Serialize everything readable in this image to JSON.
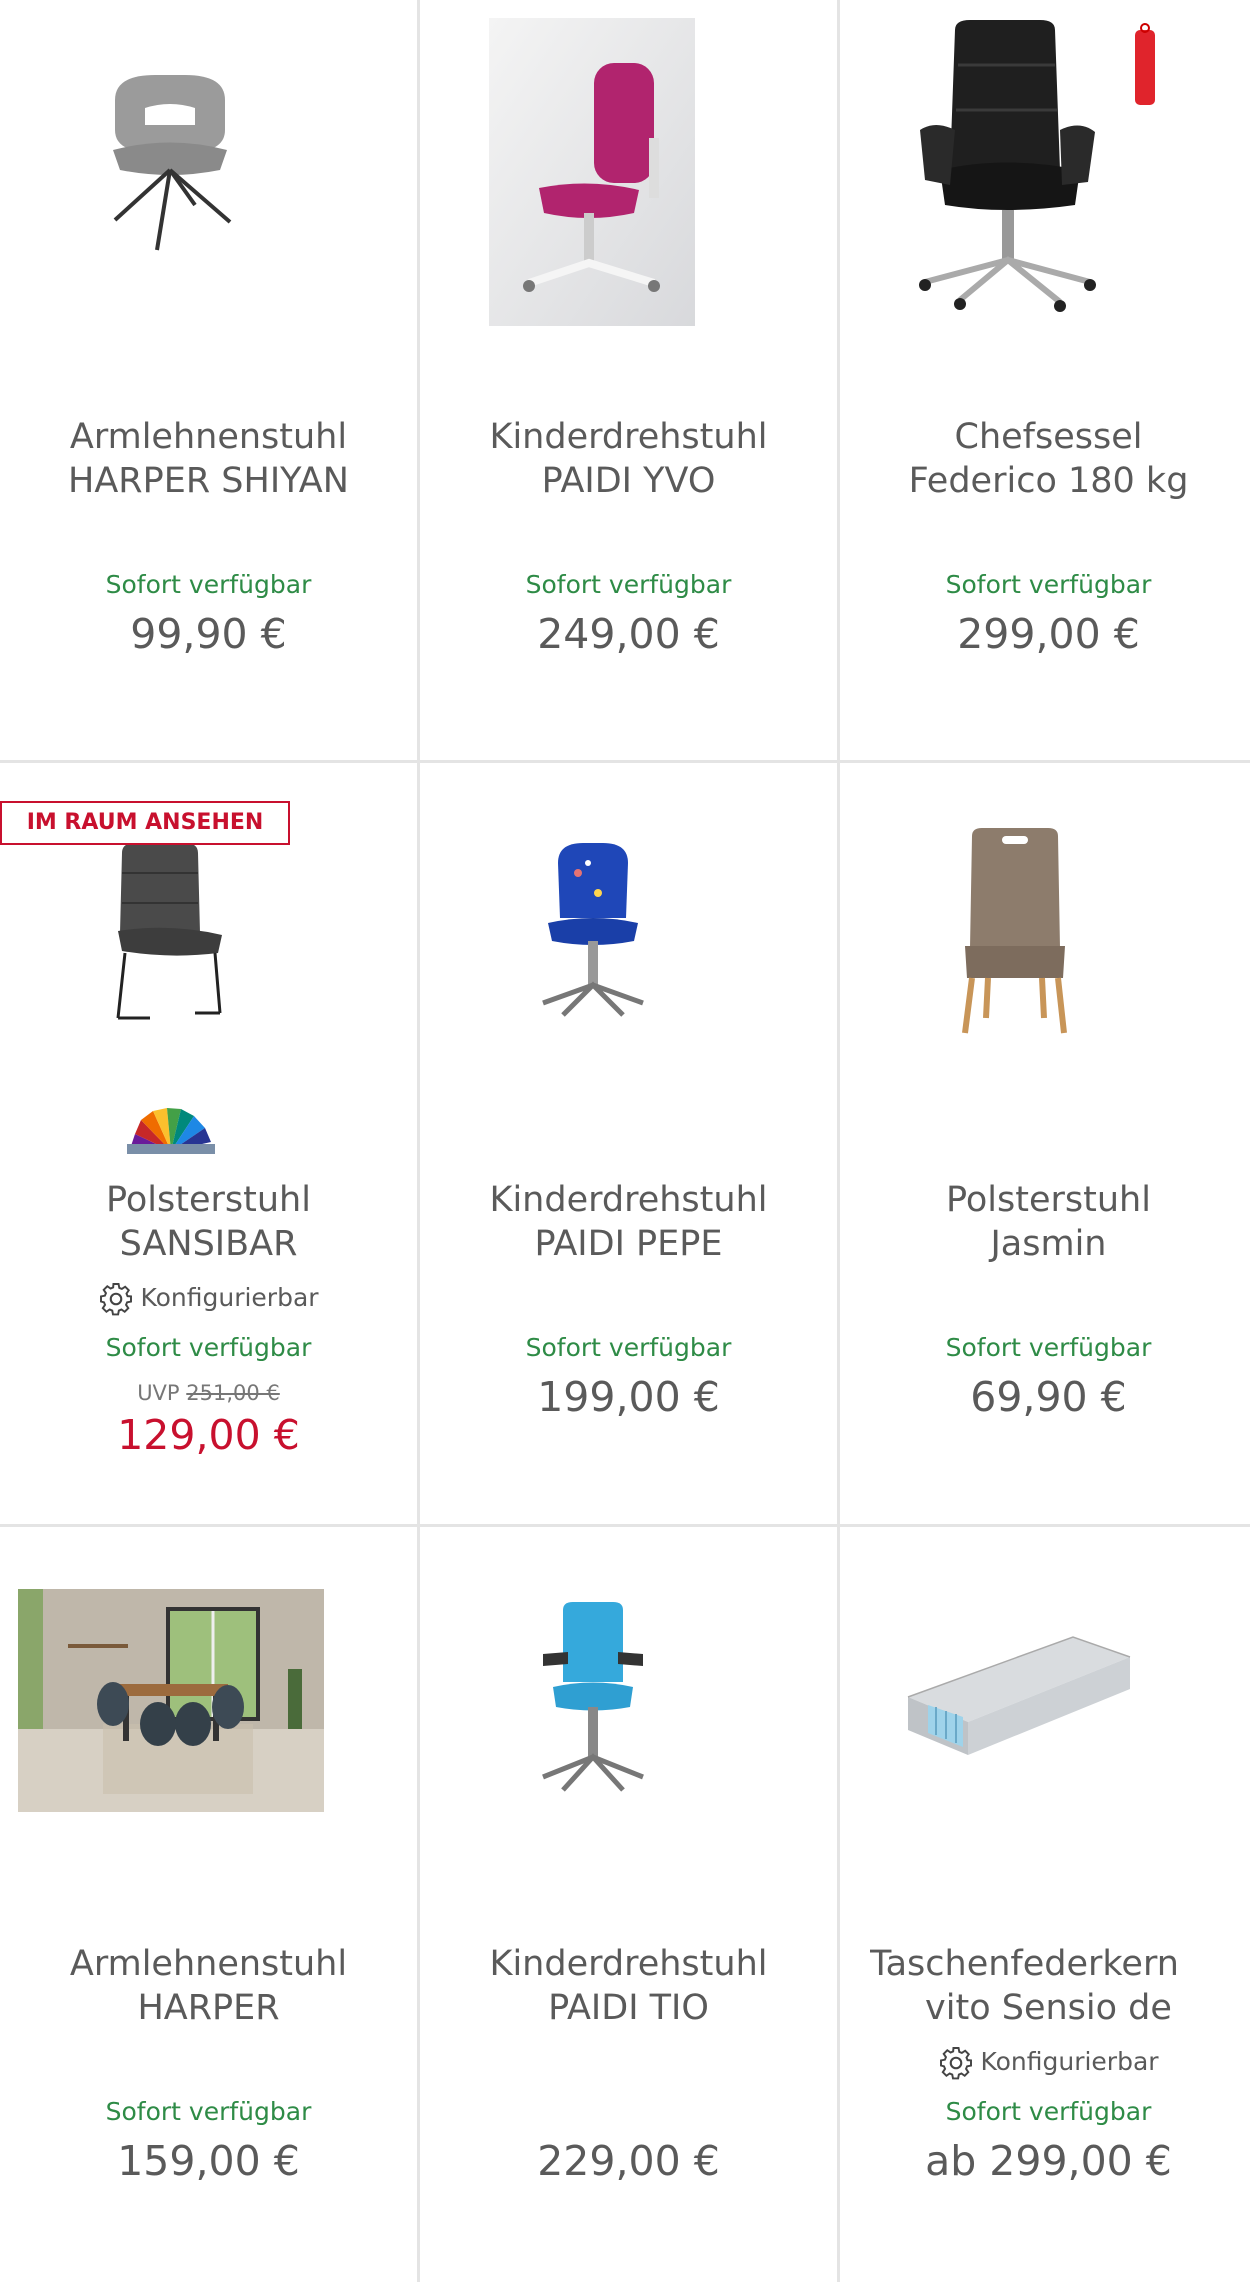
{
  "products": [
    {
      "title1": "Armlehnenstuhl",
      "title2": "HARPER SHIYAN",
      "availability": "Sofort verfügbar",
      "price": "99,90 €",
      "image_icon": "armchair-grey-image"
    },
    {
      "title1": "Kinderdrehstuhl",
      "title2": "PAIDI YVO",
      "availability": "Sofort verfügbar",
      "price": "249,00 €",
      "image_icon": "kids-swivel-chair-pink-image"
    },
    {
      "title1": "Chefsessel",
      "title2": "Federico 180 kg",
      "availability": "Sofort verfügbar",
      "price": "299,00 €",
      "image_icon": "executive-chair-black-image"
    },
    {
      "badge": "IM RAUM ANSEHEN",
      "title1": "Polsterstuhl",
      "title2": "SANSIBAR",
      "configurable": "Konfigurierbar",
      "availability": "Sofort verfügbar",
      "uvp_label": "UVP",
      "uvp_price": "251,00 €",
      "price": "129,00 €",
      "image_icon": "upholstered-chair-anthracite-image"
    },
    {
      "title1": "Kinderdrehstuhl",
      "title2": "PAIDI PEPE",
      "availability": "Sofort verfügbar",
      "price": "199,00 €",
      "image_icon": "kids-swivel-chair-blue-image"
    },
    {
      "title1": "Polsterstuhl",
      "title2": "Jasmin",
      "availability": "Sofort verfügbar",
      "price": "69,90 €",
      "image_icon": "upholstered-chair-taupe-image"
    },
    {
      "title1": "Armlehnenstuhl",
      "title2": "HARPER",
      "availability": "Sofort verfügbar",
      "price": "159,00 €",
      "image_icon": "dining-room-scene-image"
    },
    {
      "title1": "Kinderdrehstuhl",
      "title2": "PAIDI TIO",
      "availability": "",
      "price": "229,00 €",
      "image_icon": "kids-swivel-chair-turquoise-image"
    },
    {
      "title1": "Taschenfederkern",
      "title2": "vito Sensio de",
      "configurable": "Konfigurierbar",
      "availability": "Sofort verfügbar",
      "price": "ab 299,00 €",
      "image_icon": "pocket-spring-mattress-image"
    }
  ],
  "colors": {
    "available": "#2e8b46",
    "sale": "#c8102e",
    "text": "#5a5a5a",
    "divider": "#e4e4e4"
  }
}
